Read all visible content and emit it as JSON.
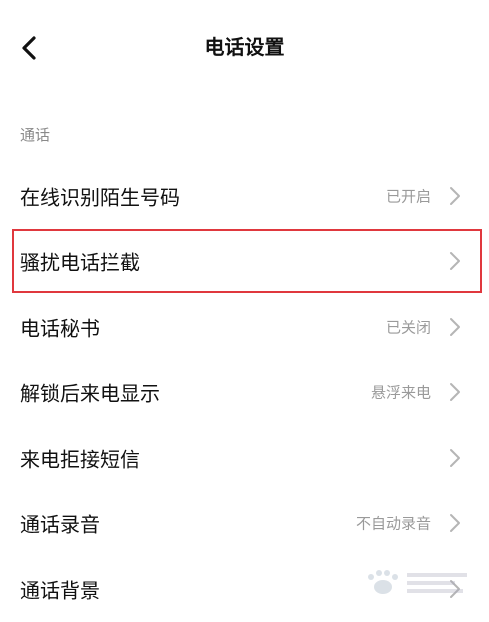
{
  "header": {
    "title": "电话设置"
  },
  "section": {
    "label": "通话"
  },
  "items": [
    {
      "label": "在线识别陌生号码",
      "status": "已开启"
    },
    {
      "label": "骚扰电话拦截",
      "status": ""
    },
    {
      "label": "电话秘书",
      "status": "已关闭"
    },
    {
      "label": "解锁后来电显示",
      "status": "悬浮来电"
    },
    {
      "label": "来电拒接短信",
      "status": ""
    },
    {
      "label": "通话录音",
      "status": "不自动录音"
    },
    {
      "label": "通话背景",
      "status": ""
    }
  ],
  "highlight": {
    "item_index": 1,
    "color": "#e0383e"
  },
  "icons": {
    "back": "back-arrow-icon",
    "chevron": "chevron-right-icon",
    "watermark": "baidu-jingyan-watermark-logo"
  }
}
